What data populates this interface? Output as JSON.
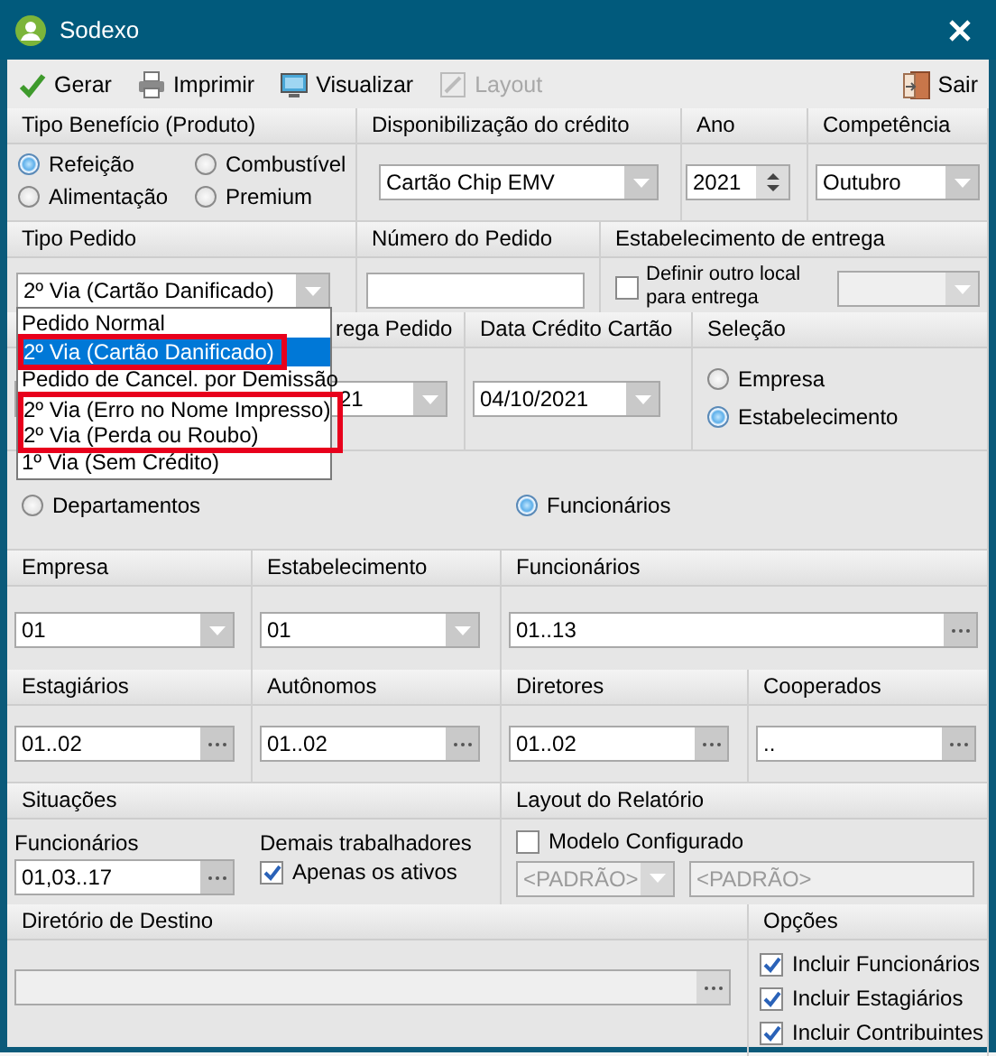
{
  "window": {
    "title": "Sodexo"
  },
  "toolbar": [
    {
      "label": "Gerar",
      "disabled": false
    },
    {
      "label": "Imprimir",
      "disabled": false
    },
    {
      "label": "Visualizar",
      "disabled": false
    },
    {
      "label": "Layout",
      "disabled": true
    },
    {
      "label": "Sair",
      "disabled": false
    }
  ],
  "sections": [
    {
      "panels": [
        {
          "title": "Tipo Benefício (Produto)",
          "controls": [
            {
              "kind": "radio",
              "label": "Refeição",
              "selected": true
            },
            {
              "kind": "radio",
              "label": "Combustível",
              "selected": false
            },
            {
              "kind": "radio",
              "label": "Alimentação",
              "selected": false
            },
            {
              "kind": "radio",
              "label": "Premium",
              "selected": false
            }
          ]
        },
        {
          "title": "Disponibilização do crédito",
          "controls": [
            {
              "kind": "combo",
              "value": "Cartão Chip EMV",
              "disabled": false
            }
          ]
        },
        {
          "title": "Ano",
          "controls": [
            {
              "kind": "spin",
              "value": "2021"
            }
          ]
        },
        {
          "title": "Competência",
          "controls": [
            {
              "kind": "combo",
              "value": "Outubro",
              "disabled": false
            }
          ]
        }
      ]
    },
    {
      "panels": [
        {
          "title": "Tipo Pedido",
          "controls": [
            {
              "kind": "combo",
              "value": "2º Via (Cartão Danificado)",
              "disabled": false,
              "options": [
                {
                  "label": "Pedido Normal",
                  "selected": false,
                  "marked": false
                },
                {
                  "label": "2º Via (Cartão Danificado)",
                  "selected": true,
                  "marked": true
                },
                {
                  "label": "Pedido de Cancel. por Demissão",
                  "selected": false,
                  "marked": false
                },
                {
                  "label": "2º Via (Erro no Nome Impresso)",
                  "selected": false,
                  "marked": true
                },
                {
                  "label": "2º Via (Perda ou Roubo)",
                  "selected": false,
                  "marked": true
                },
                {
                  "label": "1º Via (Sem Crédito)",
                  "selected": false,
                  "marked": false
                }
              ]
            }
          ]
        },
        {
          "title": "Número do Pedido",
          "controls": [
            {
              "kind": "field",
              "disabled": false
            }
          ]
        },
        {
          "title": "Estabelecimento de entrega",
          "controls": [
            {
              "kind": "check",
              "label": "Definir outro local para entrega",
              "checked": false
            },
            {
              "kind": "combo",
              "disabled": true
            }
          ]
        }
      ]
    },
    {
      "panels": [
        {
          "title": "rega Pedido",
          "controls": [
            {
              "kind": "combo",
              "value": "21",
              "disabled": false
            }
          ]
        },
        {
          "title": "Data Crédito Cartão",
          "controls": [
            {
              "kind": "combo",
              "value": "04/10/2021",
              "disabled": false
            }
          ]
        },
        {
          "title": "Seleção",
          "controls": [
            {
              "kind": "radio",
              "label": "Empresa",
              "selected": false
            },
            {
              "kind": "radio",
              "label": "Estabelecimento",
              "selected": true
            }
          ]
        }
      ]
    },
    {
      "panels": [
        {
          "controls": [
            {
              "kind": "radio",
              "label": "Departamentos",
              "selected": false
            },
            {
              "kind": "radio",
              "label": "Funcionários",
              "selected": true
            }
          ]
        }
      ]
    },
    {
      "panels": [
        {
          "title": "Empresa",
          "controls": [
            {
              "kind": "combo",
              "value": "01",
              "disabled": false
            }
          ]
        },
        {
          "title": "Estabelecimento",
          "controls": [
            {
              "kind": "combo",
              "value": "01",
              "disabled": false
            }
          ]
        },
        {
          "title": "Funcionários",
          "controls": [
            {
              "kind": "picker",
              "value": "01..13",
              "disabled": false
            }
          ]
        }
      ]
    },
    {
      "panels": [
        {
          "title": "Estagiários",
          "controls": [
            {
              "kind": "picker",
              "value": "01..02",
              "disabled": false
            }
          ]
        },
        {
          "title": "Autônomos",
          "controls": [
            {
              "kind": "picker",
              "value": "01..02",
              "disabled": false
            }
          ]
        },
        {
          "title": "Diretores",
          "controls": [
            {
              "kind": "picker",
              "value": "01..02",
              "disabled": false
            }
          ]
        },
        {
          "title": "Cooperados",
          "controls": [
            {
              "kind": "picker",
              "value": "..",
              "disabled": false
            }
          ]
        }
      ]
    },
    {
      "panels": [
        {
          "title": "Situações",
          "controls": [
            {
              "kind": "label",
              "label": "Funcionários"
            },
            {
              "kind": "label",
              "label": "Demais trabalhadores"
            },
            {
              "kind": "picker",
              "value": "01,03..17",
              "disabled": false
            },
            {
              "kind": "check",
              "label": "Apenas os ativos",
              "checked": true
            }
          ]
        },
        {
          "title": "Layout do Relatório",
          "controls": [
            {
              "kind": "check",
              "label": "Modelo Configurado",
              "checked": false
            },
            {
              "kind": "combo",
              "value": "<PADRÃO>",
              "disabled": true
            },
            {
              "kind": "field",
              "value": "<PADRÃO>",
              "disabled": true
            }
          ]
        }
      ]
    },
    {
      "panels": [
        {
          "title": "Diretório de Destino",
          "controls": [
            {
              "kind": "picker",
              "disabled": true
            }
          ]
        },
        {
          "title": "Opções",
          "controls": [
            {
              "kind": "check",
              "label": "Incluir Funcionários",
              "checked": true
            },
            {
              "kind": "check",
              "label": "Incluir Estagiários",
              "checked": true
            },
            {
              "kind": "check",
              "label": "Incluir Contribuintes",
              "checked": true
            }
          ]
        }
      ]
    }
  ]
}
